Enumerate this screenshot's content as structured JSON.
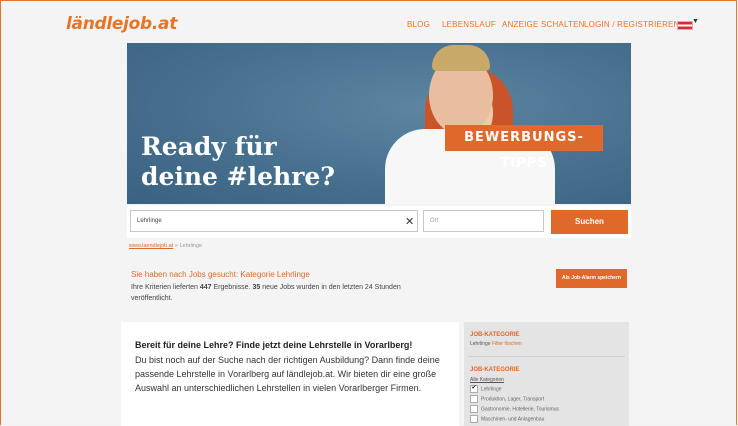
{
  "header": {
    "logo": "ländlejob.at",
    "nav": [
      "BLOG",
      "LEBENSLAUF",
      "ANZEIGE SCHALTEN",
      "LOGIN / REGISTRIEREN"
    ],
    "language_flag": "austria-flag"
  },
  "hero": {
    "title_line1": "Ready für",
    "title_line2": "deine #lehre?",
    "tips_label": "BEWERBUNGS-TIPPS"
  },
  "search": {
    "query_value": "Lehrlinge",
    "location_placeholder": "Ort",
    "button_label": "Suchen",
    "clear_icon": "close-icon"
  },
  "breadcrumb": {
    "home": "www.laendlejob.at",
    "separator": "»",
    "current": "Lehrlinge"
  },
  "results": {
    "title": "Sie haben nach Jobs gesucht: Kategorie Lehrlinge",
    "text_prefix": "Ihre Kriterien lieferten",
    "count": "447",
    "text_mid": "Ergebnisse.",
    "new_count": "35",
    "text_suffix": "neue Jobs wurden in den letzten 24 Stunden veröffentlicht.",
    "alarm_button": "Als Job-Alarm speichern"
  },
  "intro": {
    "heading": "Bereit für deine Lehre? Finde jetzt deine Lehrstelle in Vorarlberg!",
    "body": "Du bist noch auf der Suche nach der richtigen Ausbildung? Dann finde deine passende Lehrstelle in Vorarlberg auf ländlejob.at. Wir bieten dir eine große Auswahl an unterschiedlichen Lehrstellen in vielen Vorarlberger Firmen."
  },
  "sidebar": {
    "filter_heading": "JOB-KATEGORIE",
    "active_filter": "Lehrlinge",
    "clear_filter": "Filter löschen",
    "category_heading": "JOB-KATEGORIE",
    "all_categories": "Alle Kategorien",
    "categories": [
      {
        "label": "Lehrlinge",
        "checked": true
      },
      {
        "label": "Produktion, Lager, Transport",
        "checked": false
      },
      {
        "label": "Gastronomie, Hotellerie, Tourismus",
        "checked": false
      },
      {
        "label": "Maschinen- und Anlagenbau",
        "checked": false
      }
    ]
  },
  "colors": {
    "accent": "#e0682a",
    "frame": "#e8742a"
  }
}
